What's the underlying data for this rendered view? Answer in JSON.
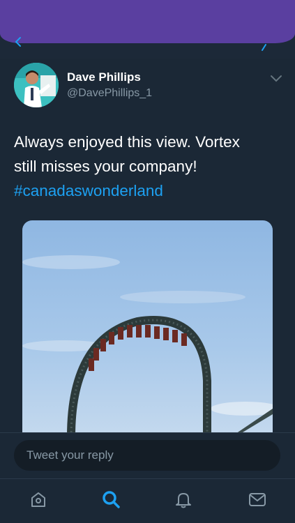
{
  "tweet": {
    "display_name": "Dave Phillips",
    "handle": "@DavePhillips_1",
    "text_line1": "Always enjoyed this view. Vortex",
    "text_line2": "still misses your company!",
    "hashtag": "#canadaswonderland"
  },
  "reply": {
    "placeholder": "Tweet your reply"
  },
  "tabbar": {
    "items": [
      {
        "icon": "home-icon"
      },
      {
        "icon": "search-icon",
        "active": true
      },
      {
        "icon": "bell-icon"
      },
      {
        "icon": "mail-icon"
      }
    ]
  },
  "colors": {
    "background": "#1b2836",
    "header_accent": "#5a3fa0",
    "link": "#1da1f2",
    "secondary_text": "#8899a6"
  }
}
